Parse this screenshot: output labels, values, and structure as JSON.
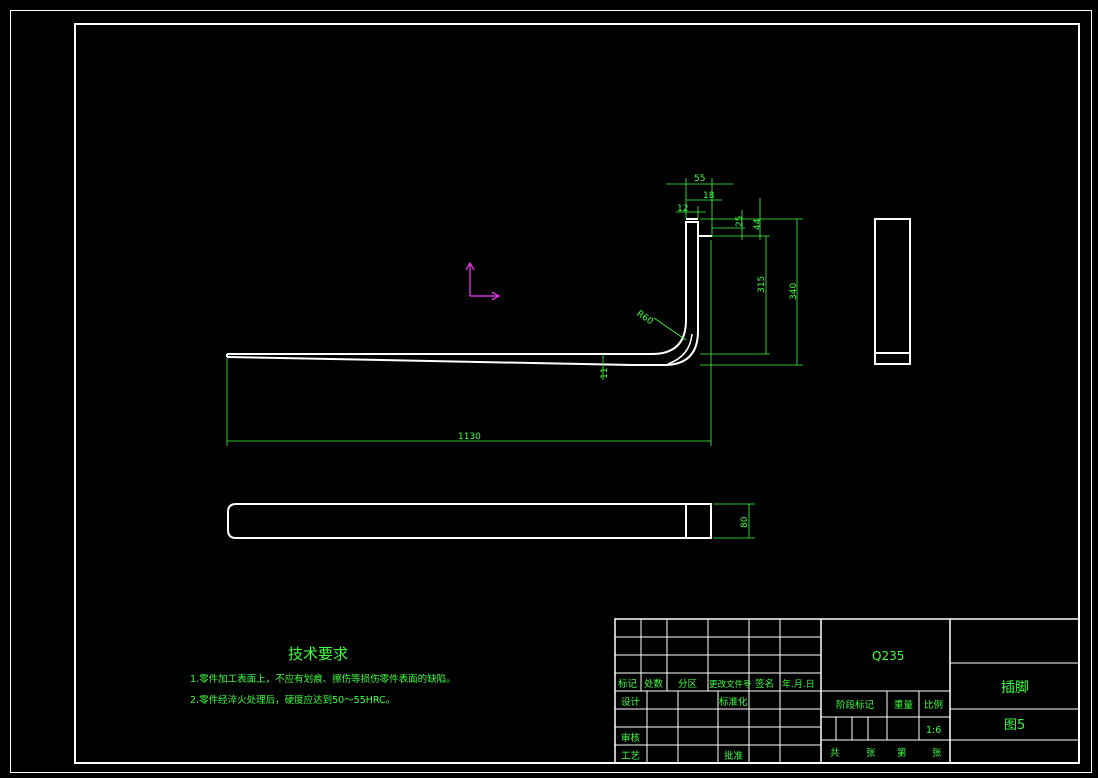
{
  "colors": {
    "background": "#000000",
    "outline": "#ffffff",
    "annotation": "#3dff3d",
    "ucs": "#ff33ff"
  },
  "dimensions": {
    "d55": "55",
    "d18": "18",
    "d12": "12",
    "d25": "25",
    "d44": "44",
    "d315": "315",
    "d340": "340",
    "radius": "R60",
    "thickness": "11",
    "length": "1130",
    "width": "80"
  },
  "tech_requirements": {
    "title": "技术要求",
    "items": [
      "1.零件加工表面上，不应有划痕、擦伤等损伤零件表面的缺陷。",
      "2.零件经淬火处理后，硬度应达到50～55HRC。"
    ]
  },
  "title_block": {
    "material": "Q235",
    "part_name": "插脚",
    "drawing_no": "图5",
    "scale_value": "1:6",
    "revision_headers": [
      "标记",
      "处数",
      "分区",
      "更改文件号",
      "签名",
      "年.月.日"
    ],
    "design_label": "设计",
    "standardization_label": "标准化",
    "review_label": "审核",
    "process_label": "工艺",
    "approve_label": "批准",
    "stage_label": "阶段标记",
    "weight_label": "重量",
    "scale_label": "比例",
    "total_label": "共",
    "sheet_unit_1": "张",
    "sheet_label": "第",
    "sheet_unit_2": "张"
  }
}
